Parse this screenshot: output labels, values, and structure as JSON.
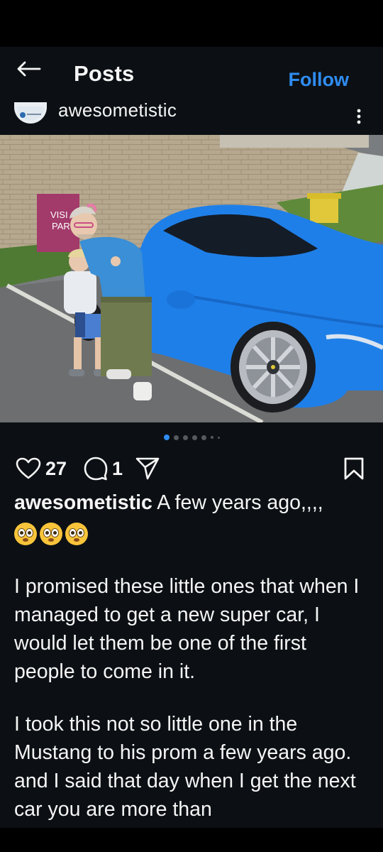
{
  "header": {
    "title": "Posts",
    "follow_label": "Follow"
  },
  "post": {
    "username": "awesometistic",
    "photo": {
      "sign_text": "VISI\nPAR",
      "car_color": "#1f7fe8"
    },
    "carousel": {
      "total_dots": 7,
      "active_index": 0
    },
    "likes": "27",
    "comments": "1",
    "caption": {
      "username": "awesometistic",
      "first_line": "A few years ago,,,,",
      "emojis": [
        "flushed-face-icon",
        "flushed-face-icon",
        "flushed-face-icon"
      ],
      "paragraphs": [
        "I promised these little ones that when I managed to get a new super car, I would let them be one of the first people to come in it.",
        "I took this not so little one in the Mustang to his prom a few years ago. and I said that day when I get the next car you are more than"
      ]
    }
  },
  "colors": {
    "background": "#0c1014",
    "accent": "#2f8cf1",
    "text": "#f5f5f5"
  }
}
